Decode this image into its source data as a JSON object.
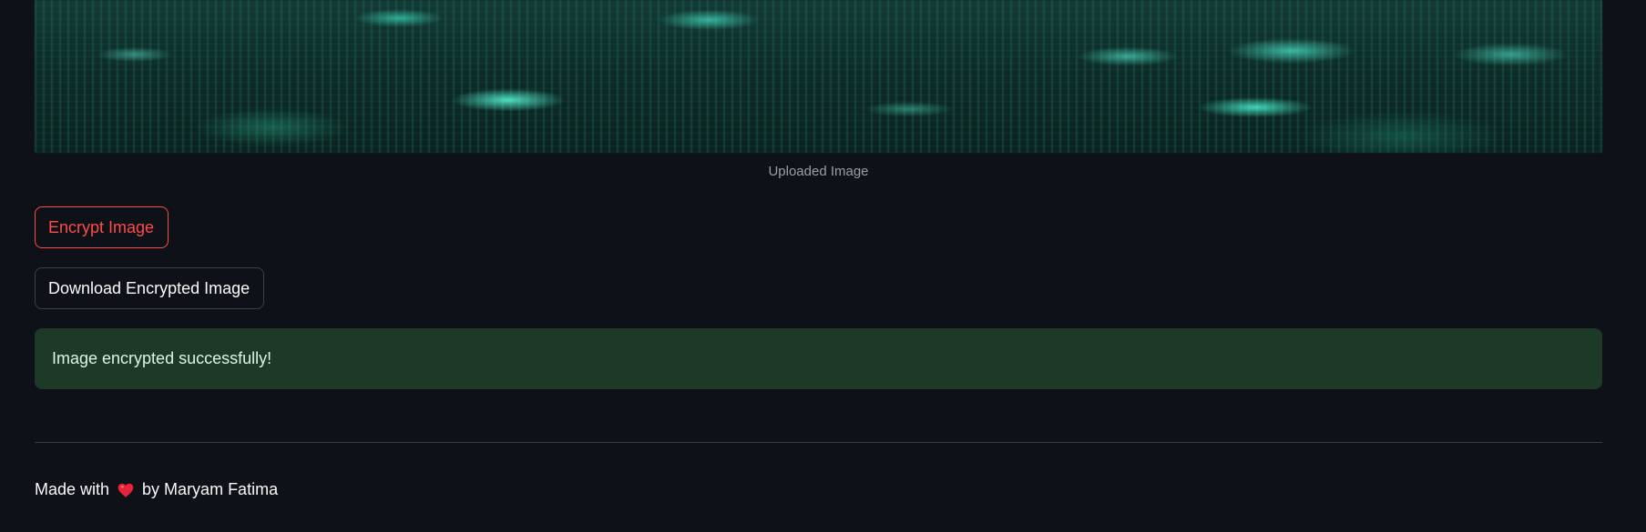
{
  "image": {
    "caption": "Uploaded Image"
  },
  "buttons": {
    "encrypt_label": "Encrypt Image",
    "download_label": "Download Encrypted Image"
  },
  "alert": {
    "message": "Image encrypted successfully!"
  },
  "footer": {
    "prefix": "Made with",
    "icon": "heart-icon",
    "suffix": "by Maryam Fatima"
  },
  "colors": {
    "background": "#0e1117",
    "primary_accent": "#ff4b4b",
    "success_background": "#1c3a27",
    "heart": "#e8233a"
  }
}
